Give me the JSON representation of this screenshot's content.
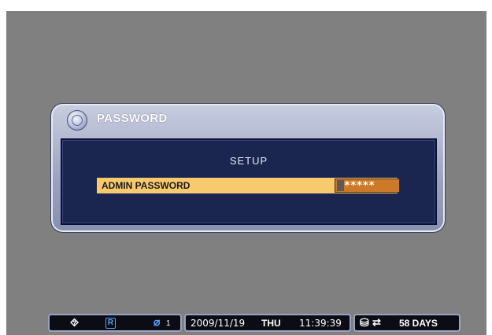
{
  "dialog": {
    "title": "PASSWORD",
    "section": "SETUP",
    "field_label": "ADMIN PASSWORD",
    "field_value": "*****"
  },
  "status": {
    "record_icon_label": "R",
    "channel_num": "1",
    "date": "2009/11/19",
    "day": "THU",
    "time": "11:39:39",
    "days_left": "58 DAYS"
  },
  "colors": {
    "background": "#808080",
    "panel": "#1a2550",
    "highlight_row": "#f7ca6e",
    "input_box": "#cc7a2a"
  }
}
